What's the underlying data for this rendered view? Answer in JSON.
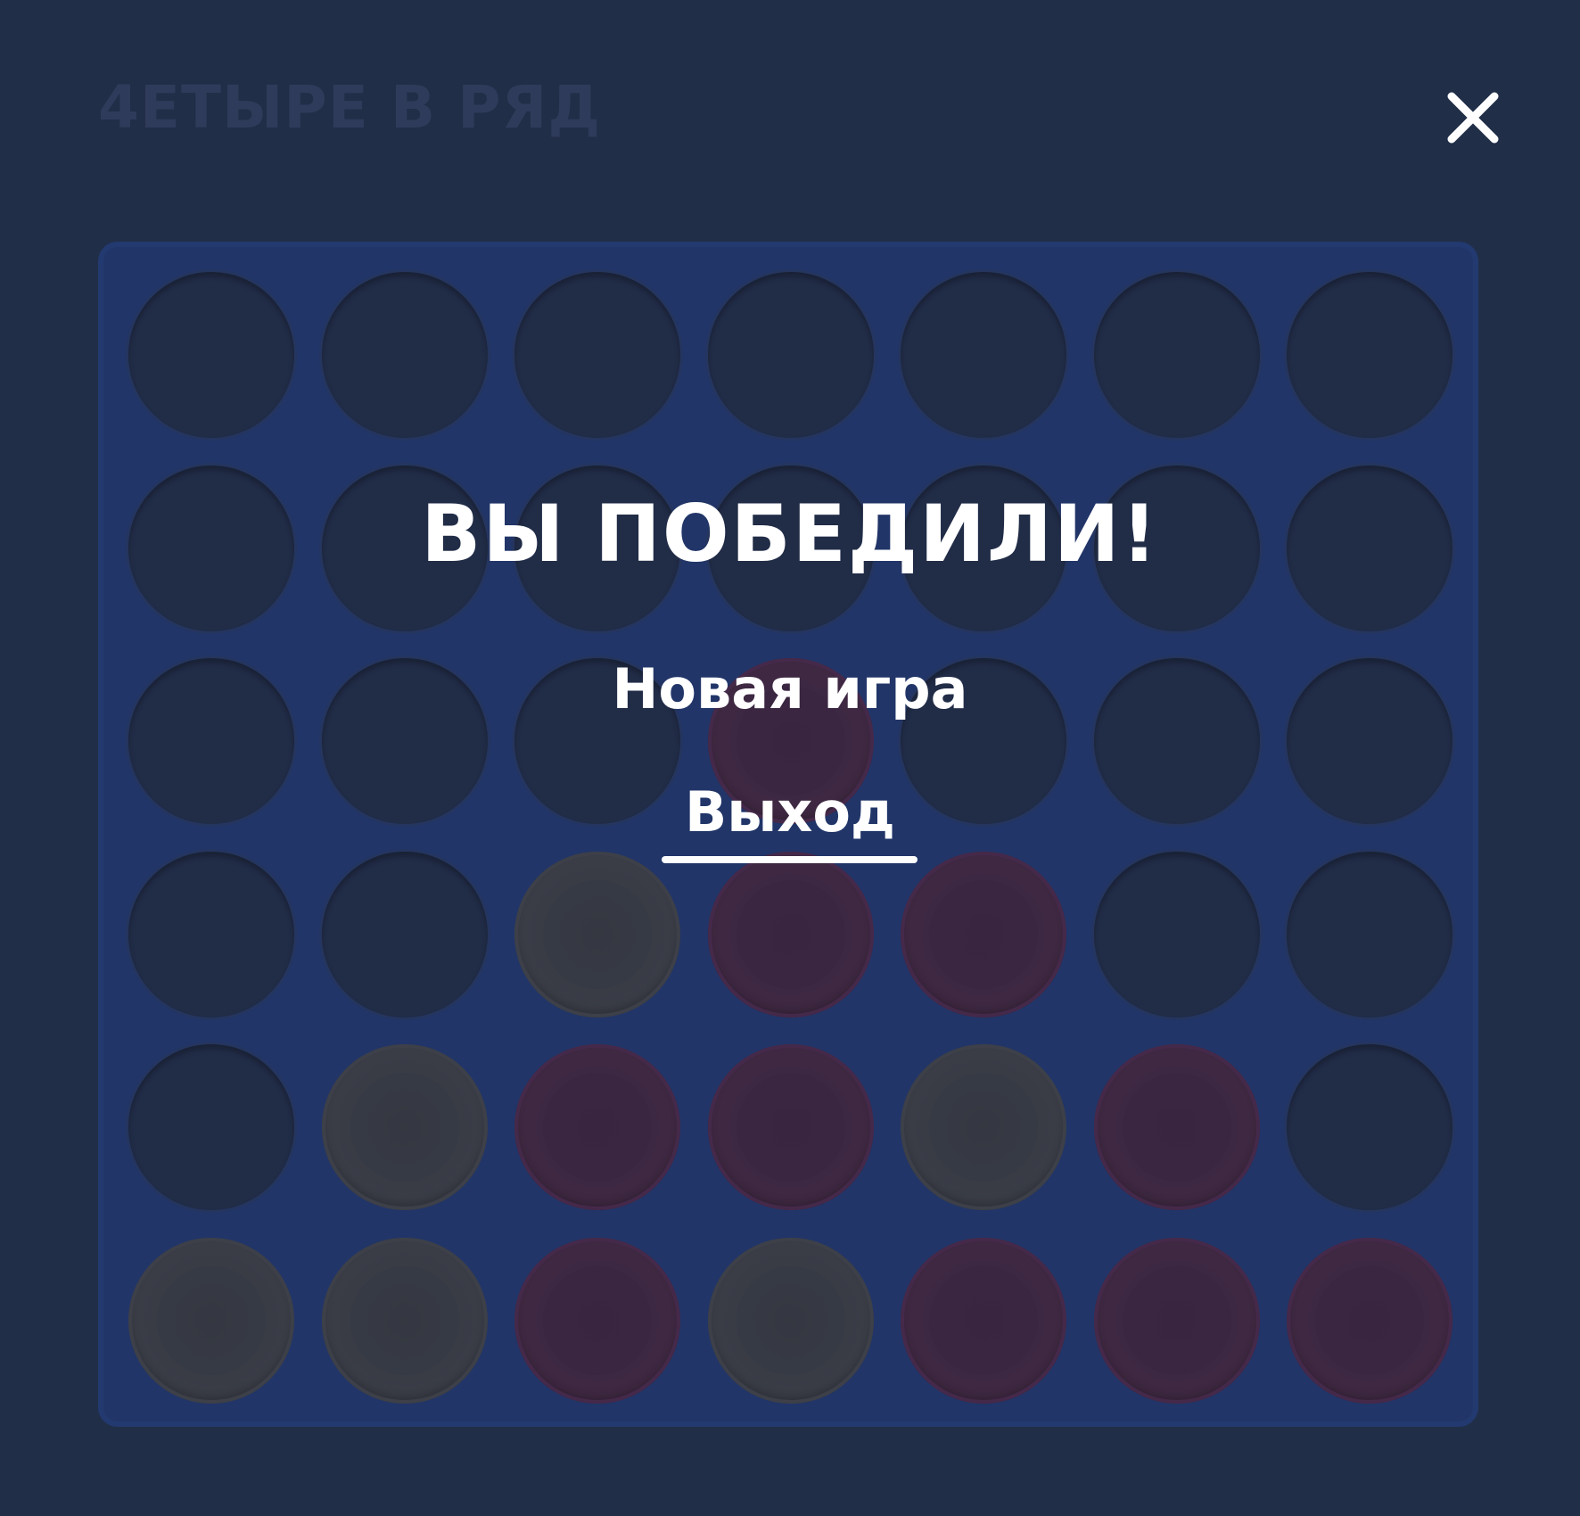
{
  "header": {
    "title": "4ЕТЫРЕ В РЯД",
    "close_icon": "close-icon"
  },
  "dialog": {
    "result_title": "ВЫ ПОБЕДИЛИ!",
    "new_game_label": "Новая игра",
    "exit_label": "Выход"
  },
  "board": {
    "rows": 6,
    "cols": 7,
    "cells": [
      [
        "empty",
        "empty",
        "empty",
        "empty",
        "empty",
        "empty",
        "empty"
      ],
      [
        "empty",
        "empty",
        "empty",
        "empty",
        "empty",
        "empty",
        "empty"
      ],
      [
        "empty",
        "empty",
        "empty",
        "red",
        "empty",
        "empty",
        "empty"
      ],
      [
        "empty",
        "empty",
        "yellow",
        "red",
        "red",
        "empty",
        "empty"
      ],
      [
        "empty",
        "yellow",
        "red",
        "red",
        "yellow",
        "red",
        "empty"
      ],
      [
        "yellow",
        "yellow",
        "red",
        "yellow",
        "red",
        "red",
        "red"
      ]
    ]
  },
  "colors": {
    "background": "#212e48",
    "board": "#213568",
    "yellow_disc": "#3b3e48",
    "red_disc": "#41293f",
    "text": "#ffffff"
  }
}
